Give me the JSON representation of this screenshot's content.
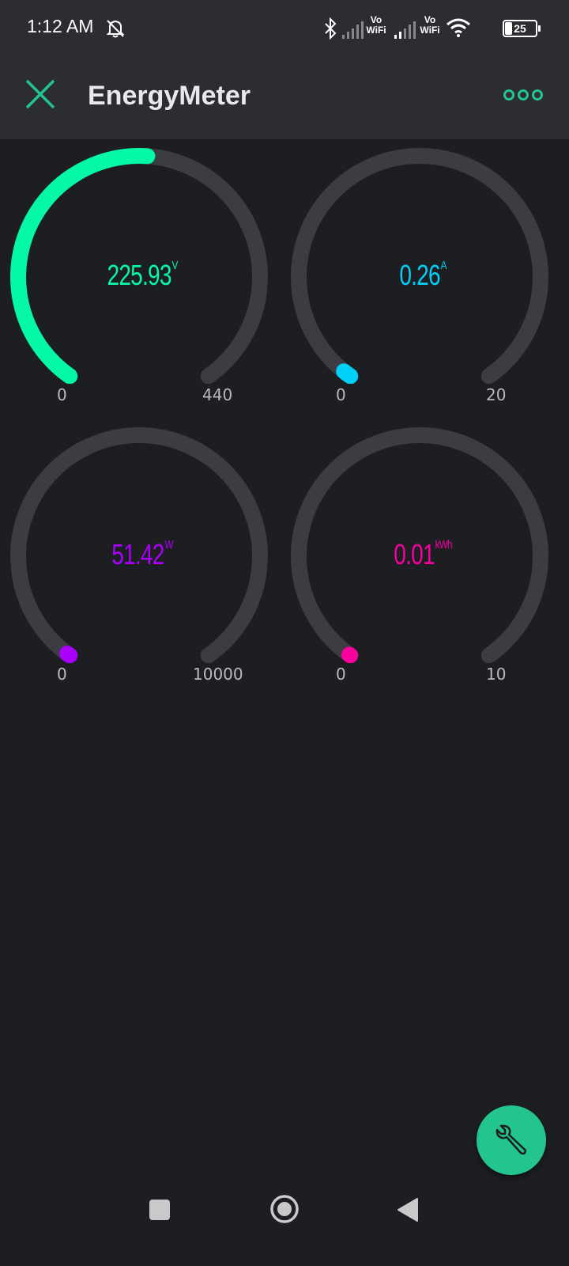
{
  "status_bar": {
    "time": "1:12 AM",
    "battery": "25",
    "network_labels": [
      "Vo",
      "WiFi",
      "Vo",
      "WiFi"
    ],
    "icons": [
      "mute-bell-icon",
      "bluetooth-icon",
      "signal-icon",
      "signal-icon",
      "wifi-icon",
      "battery-icon"
    ]
  },
  "app_bar": {
    "title": "EnergyMeter",
    "close_icon": "close-icon",
    "menu_icon": "more-dots-icon",
    "accent": "#23c48e"
  },
  "gauges": [
    {
      "value": "225.93",
      "unit": "V",
      "min": "0",
      "max": "440",
      "level": 225.93,
      "color": "#04f8a5"
    },
    {
      "value": "0.26",
      "unit": "A",
      "min": "0",
      "max": "20",
      "level": 0.26,
      "color": "#00d0f8"
    },
    {
      "value": "51.42",
      "unit": "W",
      "min": "0",
      "max": "10000",
      "level": 51.42,
      "color": "#a800f8"
    },
    {
      "value": "0.01",
      "unit": "kWh",
      "min": "0",
      "max": "10",
      "level": 0.01,
      "color": "#f8009e"
    }
  ],
  "fab": {
    "icon": "wrench-icon",
    "color": "#23c48e"
  },
  "nav": {
    "icons": [
      "recent-apps-icon",
      "home-icon",
      "back-icon"
    ]
  }
}
